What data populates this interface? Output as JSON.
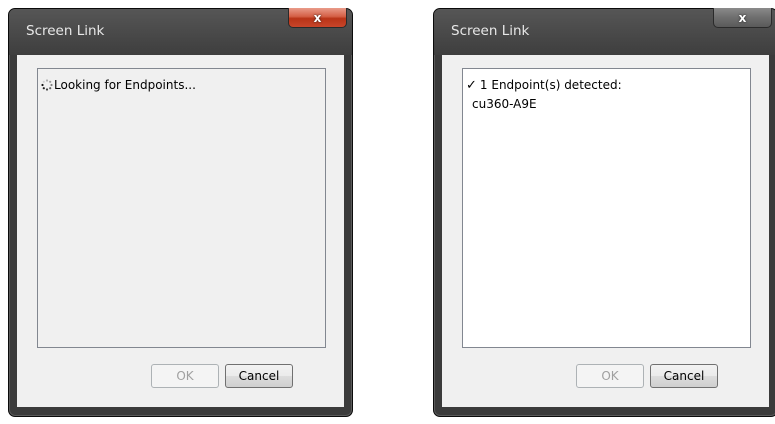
{
  "dialogs": [
    {
      "title": "Screen Link",
      "close_label": "x",
      "status_icon": "spinner-icon",
      "status_text": "Looking for Endpoints...",
      "ok_label": "OK",
      "ok_enabled": false,
      "cancel_label": "Cancel"
    },
    {
      "title": "Screen Link",
      "close_label": "x",
      "status_icon": "checkmark-icon",
      "status_text": "1 Endpoint(s) detected:",
      "endpoints": [
        "cu360-A9E"
      ],
      "ok_label": "OK",
      "ok_enabled": false,
      "cancel_label": "Cancel"
    }
  ],
  "check_glyph": "✓",
  "colors": {
    "frame": "#3b3b3b",
    "client": "#f0f0f0",
    "close_active": "#c8452a",
    "disabled_text": "#a0a0a0"
  }
}
